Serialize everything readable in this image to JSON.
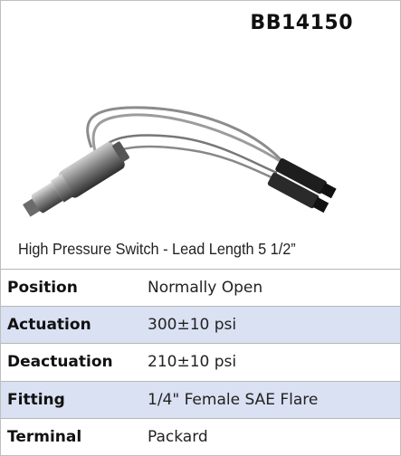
{
  "part_number": "BB14150",
  "photo": {
    "subject": "pressure-switch-icon"
  },
  "caption": "High Pressure Switch - Lead Length 5 1/2”",
  "specs": [
    {
      "label": "Position",
      "value": "Normally Open"
    },
    {
      "label": "Actuation",
      "value": "300±10 psi"
    },
    {
      "label": "Deactuation",
      "value": "210±10 psi"
    },
    {
      "label": "Fitting",
      "value": "1/4\" Female SAE Flare"
    },
    {
      "label": "Terminal",
      "value": "Packard"
    }
  ],
  "colors": {
    "shaded_row": "#d9e1f2",
    "border": "#b7b7b7"
  }
}
